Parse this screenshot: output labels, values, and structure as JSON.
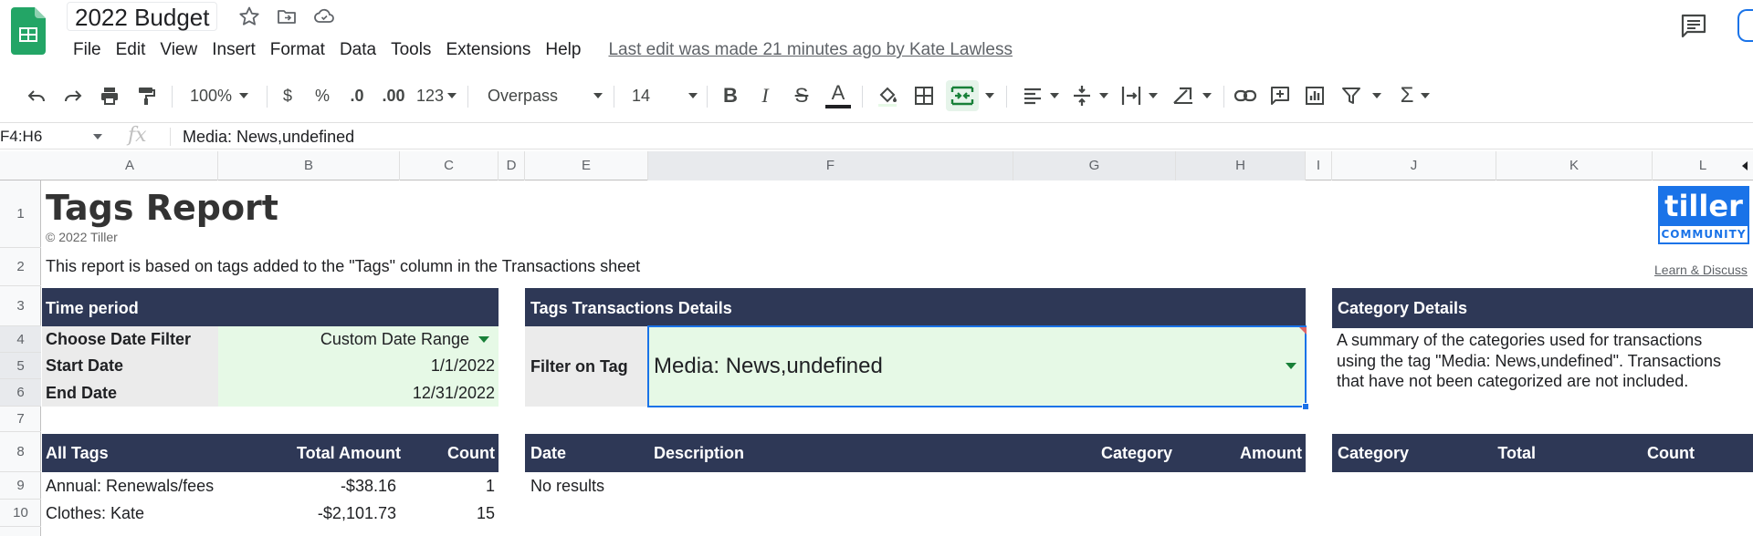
{
  "doc": {
    "title": "2022 Budget"
  },
  "menu": [
    "File",
    "Edit",
    "View",
    "Insert",
    "Format",
    "Data",
    "Tools",
    "Extensions",
    "Help"
  ],
  "last_edit": "Last edit was made 21 minutes ago by Kate Lawless",
  "toolbar": {
    "zoom": "100%",
    "currency": "$",
    "percent": "%",
    "decrease_decimal": ".0",
    "increase_decimal": ".00",
    "more_formats": "123",
    "font": "Overpass",
    "font_size": "14"
  },
  "formula": {
    "name_box": "F4:H6",
    "fx": "fx",
    "value": "Media: News,undefined"
  },
  "columns": [
    "A",
    "B",
    "C",
    "D",
    "E",
    "F",
    "G",
    "H",
    "I",
    "J",
    "K",
    "L"
  ],
  "rows": [
    "1",
    "2",
    "3",
    "4",
    "5",
    "6",
    "7",
    "8",
    "9",
    "10"
  ],
  "report": {
    "title": "Tags Report",
    "copyright": "© 2022 Tiller",
    "subtitle": "This report is based on tags added to the \"Tags\" column in the Transactions sheet",
    "logo_top": "tiller",
    "logo_bottom": "COMMUNITY",
    "learn_link": "Learn & Discuss"
  },
  "time_period": {
    "header": "Time period",
    "rows": [
      {
        "label": "Choose Date Filter",
        "value": "Custom Date Range"
      },
      {
        "label": "Start Date",
        "value": "1/1/2022"
      },
      {
        "label": "End Date",
        "value": "12/31/2022"
      }
    ]
  },
  "tag_details": {
    "header": "Tags Transactions Details",
    "filter_label": "Filter on Tag",
    "filter_value": "Media: News,undefined",
    "table_headers": [
      "Date",
      "Description",
      "Category",
      "Amount"
    ],
    "empty_text": "No results"
  },
  "category_details": {
    "header": "Category Details",
    "description": [
      "A summary of the categories used for transactions",
      "using the tag \"Media: News,undefined\". Transactions",
      "that have not been categorized are not included."
    ],
    "table_headers": [
      "Category",
      "Total",
      "Count"
    ]
  },
  "all_tags": {
    "headers": [
      "All Tags",
      "Total Amount",
      "Count"
    ],
    "rows": [
      {
        "tag": "Annual: Renewals/fees",
        "total": "-$38.16",
        "count": "1"
      },
      {
        "tag": "Clothes: Kate",
        "total": "-$2,101.73",
        "count": "15"
      }
    ]
  },
  "colors": {
    "header_navy": "#2e3856",
    "input_green": "#e6f9e6",
    "label_gray": "#ebebeb",
    "selection_blue": "#1a73e8"
  }
}
